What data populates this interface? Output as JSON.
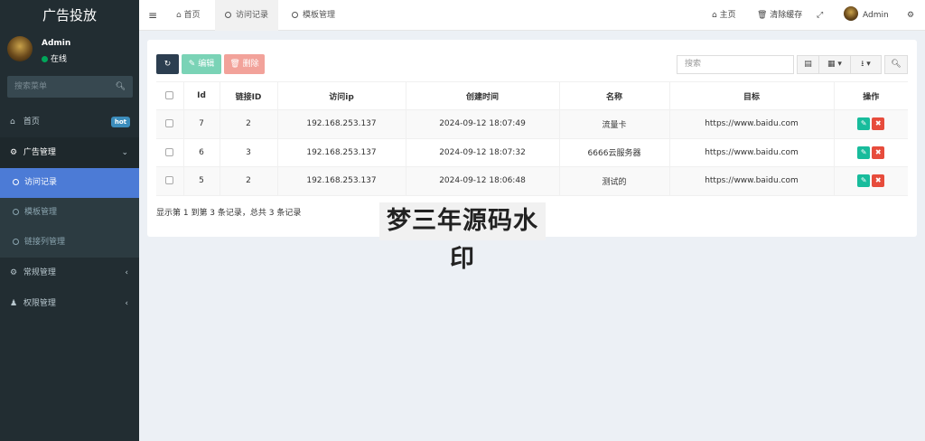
{
  "sidebar": {
    "brand": "广告投放",
    "user": {
      "name": "Admin",
      "status": "在线"
    },
    "search_placeholder": "搜索菜单",
    "menu": {
      "home": {
        "label": "首页",
        "badge": "hot"
      },
      "ad_manage": {
        "label": "广告管理"
      },
      "sub": [
        {
          "label": "访问记录"
        },
        {
          "label": "模板管理"
        },
        {
          "label": "链接列管理"
        }
      ],
      "regular": {
        "label": "常规管理"
      },
      "permission": {
        "label": "权限管理"
      }
    }
  },
  "header": {
    "tabs": [
      {
        "label": "首页"
      },
      {
        "label": "访问记录"
      },
      {
        "label": "模板管理"
      }
    ],
    "right": {
      "home": "主页",
      "clear_cache": "清除缓存",
      "user": "Admin"
    }
  },
  "toolbar": {
    "edit": "编辑",
    "delete": "删除",
    "search_placeholder": "搜索"
  },
  "table": {
    "columns": [
      "Id",
      "链接ID",
      "访问ip",
      "创建时间",
      "名称",
      "目标",
      "操作"
    ],
    "rows": [
      {
        "id": "7",
        "link_id": "2",
        "ip": "192.168.253.137",
        "time": "2024-09-12 18:07:49",
        "name": "流量卡",
        "target": "https://www.baidu.com"
      },
      {
        "id": "6",
        "link_id": "3",
        "ip": "192.168.253.137",
        "time": "2024-09-12 18:07:32",
        "name": "6666云服务器",
        "target": "https://www.baidu.com"
      },
      {
        "id": "5",
        "link_id": "2",
        "ip": "192.168.253.137",
        "time": "2024-09-12 18:06:48",
        "name": "测试的",
        "target": "https://www.baidu.com"
      }
    ],
    "summary": "显示第 1 到第 3 条记录，总共 3 条记录"
  },
  "watermark": "梦三年源码水印"
}
